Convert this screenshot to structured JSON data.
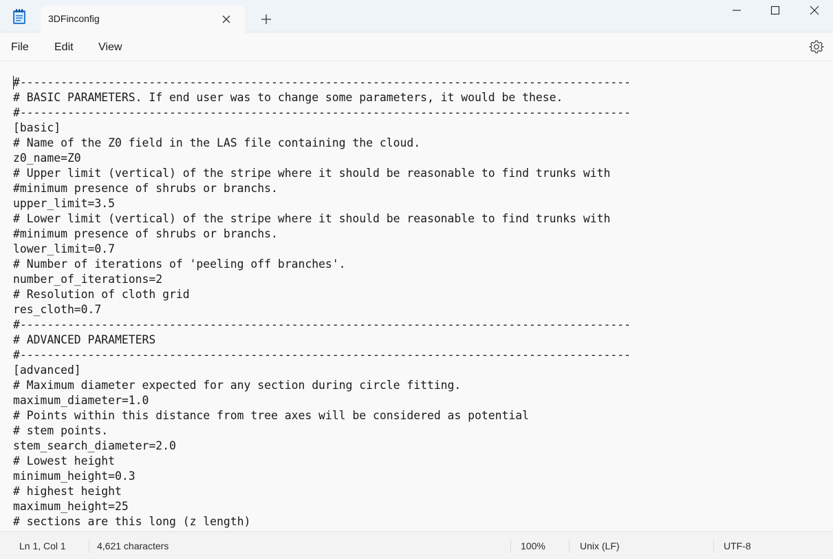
{
  "window": {
    "tab_title": "3DFinconfig"
  },
  "icons": {
    "app": "notepad-icon",
    "close_tab": "close-icon",
    "new_tab": "plus-icon",
    "minimize": "minimize-icon",
    "maximize": "maximize-icon",
    "close_window": "close-icon",
    "settings": "gear-icon"
  },
  "menu": {
    "file": "File",
    "edit": "Edit",
    "view": "View"
  },
  "editor": {
    "lines": [
      "#------------------------------------------------------------------------------------------",
      "# BASIC PARAMETERS. If end user was to change some parameters, it would be these.",
      "#------------------------------------------------------------------------------------------",
      "[basic]",
      "# Name of the Z0 field in the LAS file containing the cloud.",
      "z0_name=Z0",
      "# Upper limit (vertical) of the stripe where it should be reasonable to find trunks with",
      "#minimum presence of shrubs or branchs.",
      "upper_limit=3.5",
      "# Lower limit (vertical) of the stripe where it should be reasonable to find trunks with",
      "#minimum presence of shrubs or branchs.",
      "lower_limit=0.7",
      "# Number of iterations of 'peeling off branches'.",
      "number_of_iterations=2",
      "# Resolution of cloth grid",
      "res_cloth=0.7",
      "#------------------------------------------------------------------------------------------",
      "# ADVANCED PARAMETERS",
      "#------------------------------------------------------------------------------------------",
      "[advanced]",
      "# Maximum diameter expected for any section during circle fitting.",
      "maximum_diameter=1.0",
      "# Points within this distance from tree axes will be considered as potential",
      "# stem points.",
      "stem_search_diameter=2.0",
      "# Lowest height",
      "minimum_height=0.3",
      "# highest height",
      "maximum_height=25",
      "# sections are this long (z length)"
    ]
  },
  "status": {
    "position": "Ln 1, Col 1",
    "characters": "4,621 characters",
    "zoom": "100%",
    "line_ending": "Unix (LF)",
    "encoding": "UTF-8"
  },
  "colors": {
    "titlebar_bg": "#eff4f9",
    "editor_bg": "#f9f9f9",
    "text": "#1a1a1a",
    "app_icon_blue": "#2b7cd3"
  }
}
